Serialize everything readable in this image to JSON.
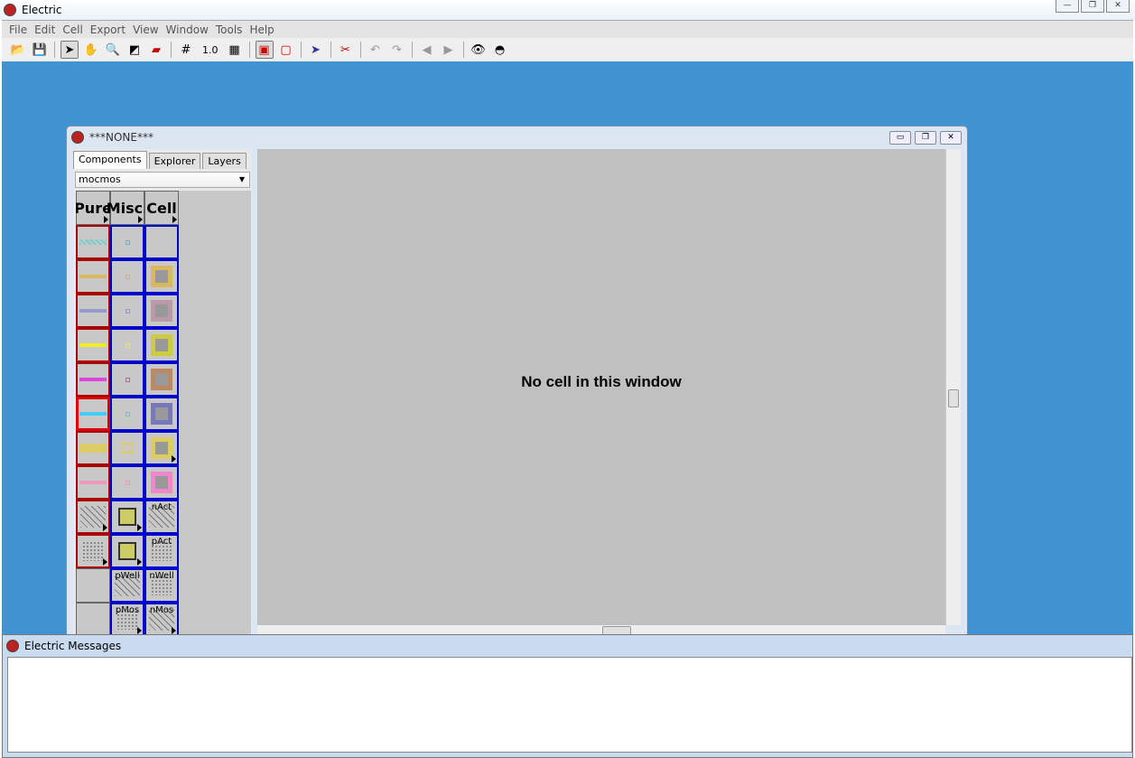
{
  "app": {
    "title": "Electric"
  },
  "menu": [
    "File",
    "Edit",
    "Cell",
    "Export",
    "View",
    "Window",
    "Tools",
    "Help"
  ],
  "toolbar": {
    "scale_label": "1.0"
  },
  "window": {
    "title": "***NONE***",
    "tabs": [
      "Components",
      "Explorer",
      "Layers"
    ],
    "technology": "mocmos",
    "palette_headers": [
      "Pure",
      "Misc.",
      "Cell"
    ],
    "cells": [
      [
        {
          "b": "red",
          "c": "#7cc",
          "k": "hatch"
        },
        {
          "b": "blue",
          "c": "#3cc",
          "k": "dot"
        },
        {
          "b": "blue",
          "c": "",
          "k": "empty"
        }
      ],
      [
        {
          "b": "red",
          "c": "#d9b860",
          "k": "line"
        },
        {
          "b": "blue",
          "c": "#d9b860",
          "k": "dot"
        },
        {
          "b": "blue",
          "c": "#d9b860",
          "k": "sq"
        }
      ],
      [
        {
          "b": "red",
          "c": "#99c",
          "k": "line"
        },
        {
          "b": "blue",
          "c": "#99c",
          "k": "dot"
        },
        {
          "b": "blue",
          "c": "#b9a",
          "k": "sq"
        }
      ],
      [
        {
          "b": "red",
          "c": "#ee2",
          "k": "line"
        },
        {
          "b": "blue",
          "c": "#ee2",
          "k": "dot"
        },
        {
          "b": "blue",
          "c": "#cc4",
          "k": "sq"
        }
      ],
      [
        {
          "b": "red",
          "c": "#d4d",
          "k": "line"
        },
        {
          "b": "blue",
          "c": "#d4d",
          "k": "dot"
        },
        {
          "b": "blue",
          "c": "#b86",
          "k": "sq"
        }
      ],
      [
        {
          "b": "red",
          "c": "#4cf",
          "k": "line",
          "sel": true
        },
        {
          "b": "blue",
          "c": "#4cf",
          "k": "dot"
        },
        {
          "b": "blue",
          "c": "#77b",
          "k": "sq"
        }
      ],
      [
        {
          "b": "red",
          "c": "#dc6",
          "k": "thick"
        },
        {
          "b": "blue",
          "c": "#dc6",
          "k": "sqs"
        },
        {
          "b": "blue",
          "c": "#dc6",
          "k": "sq",
          "t": true
        }
      ],
      [
        {
          "b": "red",
          "c": "#e9b",
          "k": "line"
        },
        {
          "b": "blue",
          "c": "#e9b",
          "k": "dot"
        },
        {
          "b": "blue",
          "c": "#e8c",
          "k": "sq"
        }
      ],
      [
        {
          "b": "red",
          "c": "#6c4",
          "k": "diag",
          "t": true
        },
        {
          "b": "blue",
          "c": "#cc6",
          "k": "x",
          "t": true
        },
        {
          "b": "blue",
          "c": "#6c4",
          "k": "diag",
          "label": "nAct"
        }
      ],
      [
        {
          "b": "red",
          "c": "#6c4",
          "k": "dots",
          "t": true
        },
        {
          "b": "blue",
          "c": "#cc6",
          "k": "x",
          "t": true
        },
        {
          "b": "blue",
          "c": "#6c4",
          "k": "dots",
          "label": "pAct"
        }
      ],
      [
        {
          "b": "none",
          "c": "",
          "k": "empty"
        },
        {
          "b": "blue",
          "c": "#6c4",
          "k": "diag",
          "label": "pWell"
        },
        {
          "b": "blue",
          "c": "#6c4",
          "k": "dots",
          "label": "nWell"
        }
      ],
      [
        {
          "b": "none",
          "c": "",
          "k": "empty"
        },
        {
          "b": "blue",
          "c": "#6c4",
          "k": "dots",
          "label": "pMos",
          "t": true
        },
        {
          "b": "blue",
          "c": "#6c4",
          "k": "diag",
          "label": "nMos",
          "t": true
        }
      ]
    ],
    "canvas_message": "No cell in this window"
  },
  "messages": {
    "title": "Electric Messages"
  }
}
